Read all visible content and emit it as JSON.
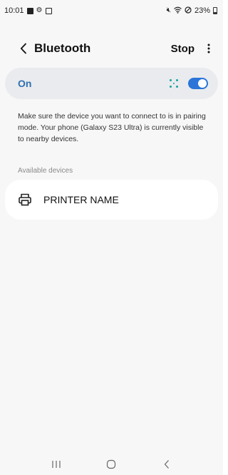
{
  "status_bar": {
    "time": "10:01",
    "left_icons": [
      "gallery-icon",
      "settings-icon",
      "checkbox-icon"
    ],
    "right_icons": [
      "mute-icon",
      "wifi-icon",
      "no-signal-icon"
    ],
    "battery": "23%",
    "battery_level": 0.23
  },
  "header": {
    "title": "Bluetooth",
    "stop_label": "Stop"
  },
  "toggle": {
    "label": "On",
    "state": true,
    "accent": "#2b75d9",
    "label_color": "#2f6fb0"
  },
  "description": "Make sure the device you want to connect to is in pairing mode. Your phone (Galaxy S23 Ultra) is currently visible to nearby devices.",
  "available": {
    "label": "Available devices",
    "devices": [
      {
        "name": "PRINTER NAME",
        "icon": "printer-icon"
      }
    ]
  },
  "nav": {
    "buttons": [
      "recents-icon",
      "home-icon",
      "back-icon"
    ]
  }
}
